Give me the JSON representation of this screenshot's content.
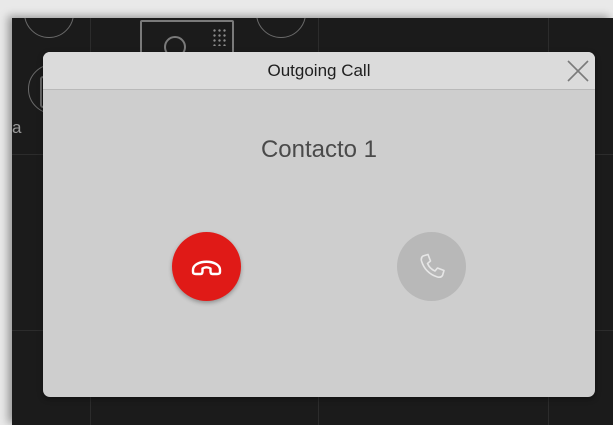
{
  "dialog": {
    "title": "Outgoing Call",
    "contact_name": "Contacto 1"
  },
  "background": {
    "partial_letter": "a"
  },
  "icons": {
    "close": "close-icon",
    "hangup": "phone-hangup-icon",
    "answer": "phone-answer-icon"
  },
  "colors": {
    "hangup": "#e01a17",
    "answer_disabled": "#b8b8b8",
    "dialog_bg": "#cecece",
    "header_bg": "#dbdbdb"
  }
}
